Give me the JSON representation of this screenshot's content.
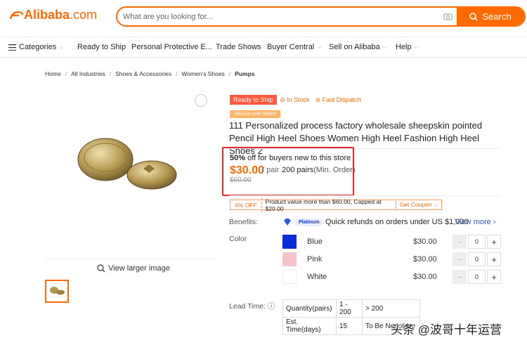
{
  "header": {
    "logo_brand": "Alibaba",
    "logo_domain": ".com",
    "search_placeholder": "What are you looking for...",
    "search_button": "Search"
  },
  "nav": {
    "categories": "Categories",
    "items": [
      "Ready to Ship",
      "Personal Protective E...",
      "Trade Shows",
      "Buyer Central",
      "Sell on Alibaba",
      "Help"
    ]
  },
  "breadcrumb": [
    "Home",
    "All Industries",
    "Shoes & Accessories",
    "Women's Shoes",
    "Pumps"
  ],
  "gallery": {
    "view_larger": "View larger image"
  },
  "product": {
    "ready_to_ship": "Ready to Ship",
    "in_stock": "In Stock",
    "fast_dispatch": "Fast Dispatch",
    "select_badge": "Alibaba.com Select",
    "title": "111 Personalized process factory wholesale sheepskin pointed Pencil High Heel Shoes Women High Heel Fashion High Heel Shoes 2",
    "discount_pct": "50%",
    "discount_text": " off for buyers new to this store",
    "price": "$30.00",
    "unit": "/ pair",
    "moq_qty": "200 pairs",
    "moq_label": "(Min. Order)",
    "original_price": "$60.00",
    "coupon": {
      "off": "4% OFF",
      "desc": "Product value more than $60.00, Capped at $20.00",
      "get": "Get Coupon"
    },
    "benefits_label": "Benefits:",
    "platinum": "Platinum",
    "benefit_text": "Quick refunds on orders under US $1,000",
    "view_more": "View more",
    "color_label": "Color",
    "colors": [
      {
        "name": "Blue",
        "price": "$30.00",
        "qty": "0",
        "swatch": "#0a2bd8"
      },
      {
        "name": "Pink",
        "price": "$30.00",
        "qty": "0",
        "swatch": "#f4c4cc"
      },
      {
        "name": "White",
        "price": "$30.00",
        "qty": "0",
        "swatch": "#ffffff"
      }
    ],
    "lead_label": "Lead Time:",
    "lead_table": [
      [
        "Quantity(pairs)",
        "1 - 200",
        "> 200"
      ],
      [
        "Est. Time(days)",
        "15",
        "To Be Negotiate"
      ]
    ]
  },
  "watermark": "头条 @波哥十年运营",
  "accent": "#ff6a00"
}
